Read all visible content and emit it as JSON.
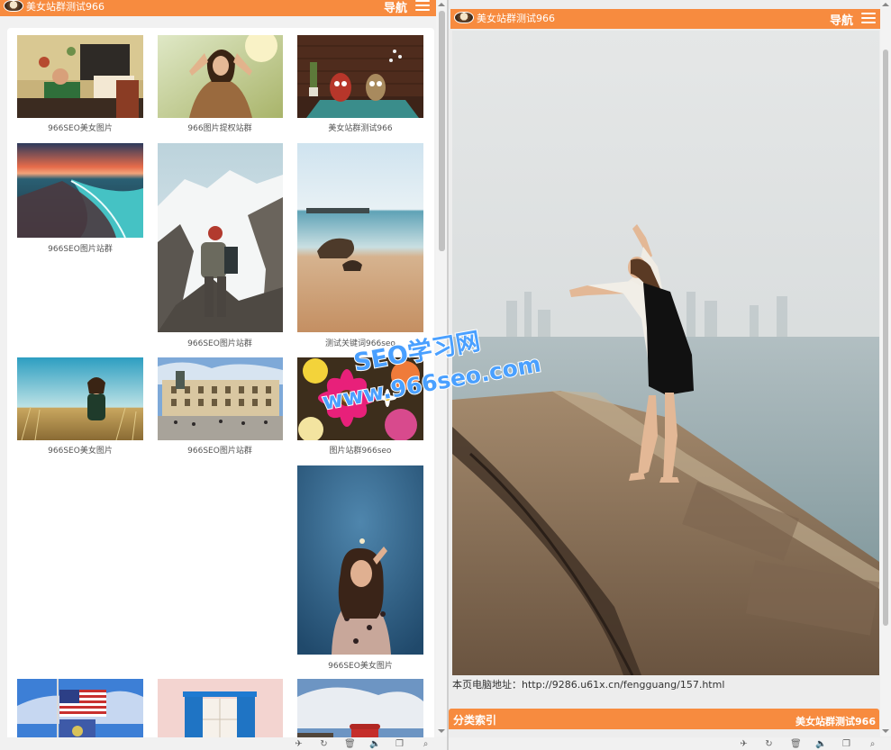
{
  "site": {
    "name": "美女站群测试966",
    "nav_label": "导航"
  },
  "gallery": {
    "items": [
      {
        "caption": "966SEO美女图片"
      },
      {
        "caption": "966图片提权站群"
      },
      {
        "caption": "美女站群测试966"
      },
      {
        "caption": "966SEO图片站群"
      },
      {
        "caption": "966SEO图片站群"
      },
      {
        "caption": "测试关键词966seo"
      },
      {
        "caption": "966SEO美女图片"
      },
      {
        "caption": "966SEO图片站群"
      },
      {
        "caption": "图片站群966seo"
      },
      {
        "caption": "966SEO美女图片"
      },
      {
        "caption": ""
      },
      {
        "caption": ""
      },
      {
        "caption": ""
      }
    ]
  },
  "watermark": {
    "line1": "SEO学习网",
    "line2": "www.966seo.com"
  },
  "detail": {
    "pc_url_label": "本页电脑地址：",
    "pc_url": "http://9286.u61x.cn/fengguang/157.html",
    "category_title": "分类索引",
    "category_site": "美女站群测试966"
  },
  "toolbar": {
    "icons": [
      "rocket-icon",
      "refresh-icon",
      "trash-icon",
      "volume-icon",
      "window-icon",
      "search-icon"
    ]
  }
}
